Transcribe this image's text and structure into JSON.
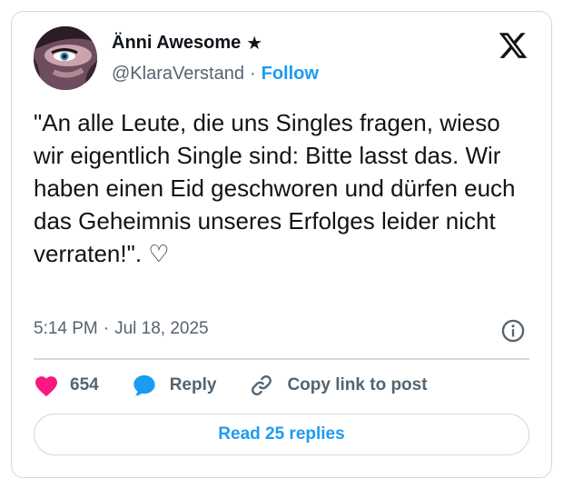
{
  "author": {
    "display_name": "Änni Awesome",
    "badge": "★",
    "handle": "@KlaraVerstand",
    "separator": "·",
    "follow_label": "Follow"
  },
  "tweet": {
    "text": "\"An alle Leute, die uns Singles fragen, wieso wir eigentlich Single sind: Bitte lasst das. Wir haben einen Eid geschworen und dürfen euch das Geheimnis unseres Erfolges leider nicht verraten!\". ♡",
    "time": "5:14 PM",
    "separator": "·",
    "date": "Jul 18, 2025"
  },
  "actions": {
    "like_count": "654",
    "reply_label": "Reply",
    "copy_label": "Copy link to post"
  },
  "read_replies_label": "Read 25 replies",
  "icons": {
    "brand": "x-logo-icon",
    "info": "info-icon",
    "like": "heart-icon",
    "reply": "speech-bubble-icon",
    "copy": "link-icon"
  },
  "colors": {
    "accent": "#1d9bf0",
    "like": "#f91880",
    "text": "#0f1419",
    "secondary": "#536471",
    "border": "#cfd9de"
  }
}
